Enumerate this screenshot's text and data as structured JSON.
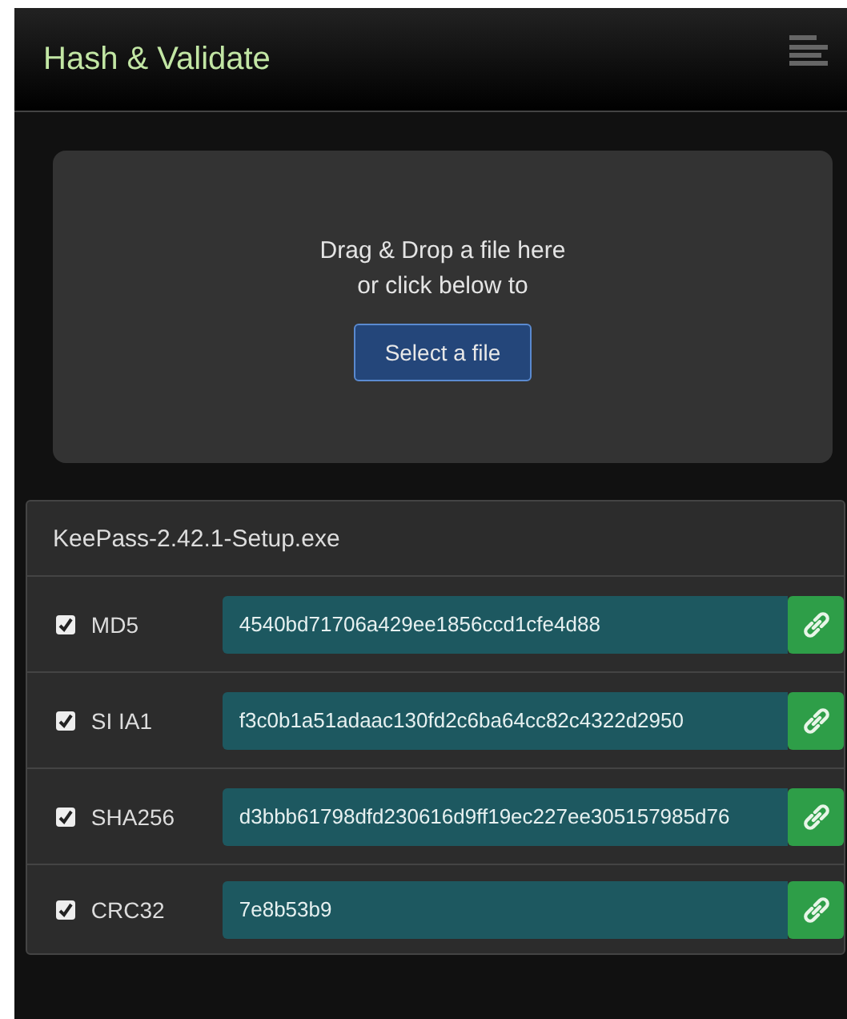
{
  "header": {
    "title": "Hash & Validate"
  },
  "dropzone": {
    "line_1": "Drag & Drop a file here",
    "line_2": "or click below to",
    "button": "Select a file"
  },
  "file": {
    "name": "KeePass-2.42.1-Setup.exe"
  },
  "hashes": [
    {
      "name": "MD5",
      "checked": true,
      "value": "4540bd71706a429ee1856ccd1cfe4d88"
    },
    {
      "name": "SI IA1",
      "checked": true,
      "value": "f3c0b1a51adaac130fd2c6ba64cc82c4322d2950"
    },
    {
      "name": "SHA256",
      "checked": true,
      "value": "d3bbb61798dfd230616d9ff19ec227ee305157985d76"
    },
    {
      "name": "CRC32",
      "checked": true,
      "value": "7e8b53b9"
    }
  ]
}
